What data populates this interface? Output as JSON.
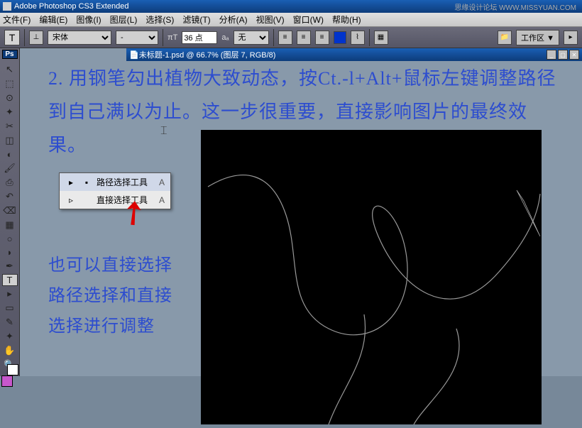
{
  "app_title": "Adobe Photoshop CS3 Extended",
  "watermark": "思缘设计论坛 WWW.MISSYUAN.COM",
  "menubar": {
    "file": "文件(F)",
    "edit": "编辑(E)",
    "image": "图像(I)",
    "layer": "图层(L)",
    "select": "选择(S)",
    "filter": "滤镜(T)",
    "analysis": "分析(A)",
    "view": "视图(V)",
    "window": "窗口(W)",
    "help": "帮助(H)"
  },
  "options": {
    "tool_letter": "T",
    "orientation": "⊥",
    "font_family": "宋体",
    "font_style": "-",
    "font_size": "36 点",
    "aa_label": "aₐ",
    "aa_value": "无",
    "workspace_label": "工作区 ▼"
  },
  "document": {
    "title": "未标题-1.psd @ 66.7% (图层 7, RGB/8)",
    "icon": "📄"
  },
  "tooltip": {
    "item1": {
      "icon1": "▸",
      "icon2": "▪",
      "label": "路径选择工具",
      "key": "A"
    },
    "item2": {
      "icon1": "▹",
      "label": "直接选择工具",
      "key": "A"
    }
  },
  "overlay1": "2. 用钢笔勾出植物大致动态，按Ct.-l+Alt+鼠标左键调整路径到自己满以为止。这一步很重要，直接影响图片的最终效果。",
  "overlay2": "也可以直接选择路径选择和直接选择进行调整",
  "tools": {
    "move": "↖",
    "marquee": "⬚",
    "lasso": "⊙",
    "wand": "✦",
    "crop": "✂",
    "slice": "◫",
    "heal": "◐",
    "brush": "🖌",
    "stamp": "⎙",
    "history": "↶",
    "eraser": "⌫",
    "gradient": "▦",
    "blur": "○",
    "dodge": "◗",
    "pen": "✒",
    "type": "T",
    "path": "▸",
    "shape": "▭",
    "notes": "✎",
    "eyedrop": "✦",
    "hand": "✋",
    "zoom": "🔍"
  },
  "ps_logo": "Ps"
}
